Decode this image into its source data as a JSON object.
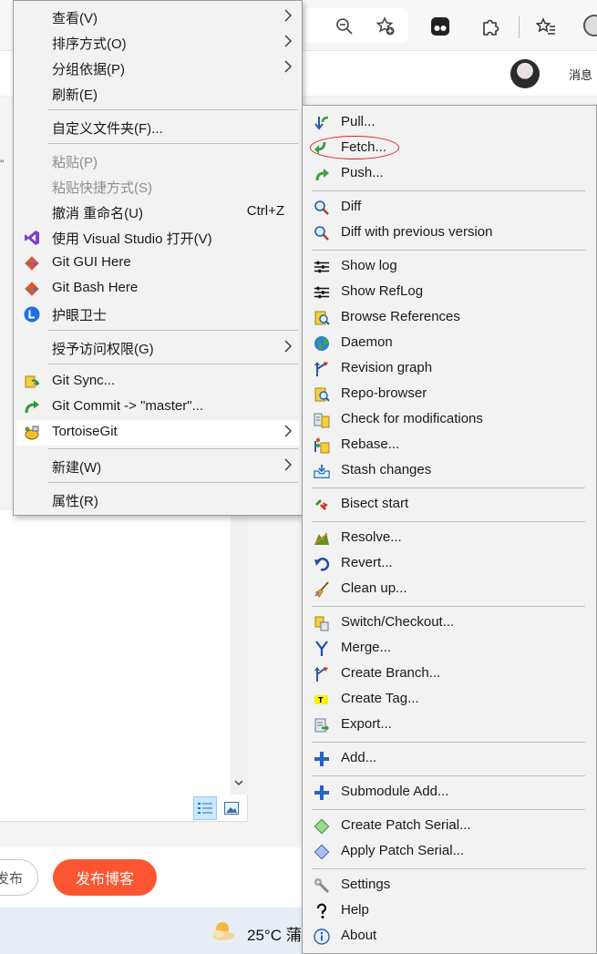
{
  "browser": {
    "message_label": "消息"
  },
  "editor": {
    "quote_char": "\"",
    "btn_secondary": "发布",
    "btn_publish": "发布博客"
  },
  "taskbar": {
    "temperature": "25°C",
    "weather_trailing": "蒲"
  },
  "main_menu": {
    "view": "查看(V)",
    "sort": "排序方式(O)",
    "group": "分组依据(P)",
    "refresh": "刷新(E)",
    "customize": "自定义文件夹(F)...",
    "paste": "粘贴(P)",
    "paste_shortcut": "粘贴快捷方式(S)",
    "undo_rename": "撤消 重命名(U)",
    "undo_shortcut": "Ctrl+Z",
    "open_vs": "使用 Visual Studio 打开(V)",
    "git_gui": "Git GUI Here",
    "git_bash": "Git Bash Here",
    "eye_guard": "护眼卫士",
    "grant_access": "授予访问权限(G)",
    "git_sync": "Git Sync...",
    "git_commit": "Git Commit -> \"master\"...",
    "tortoisegit": "TortoiseGit",
    "new": "新建(W)",
    "properties": "属性(R)"
  },
  "sub_menu": {
    "pull": "Pull...",
    "fetch": "Fetch...",
    "push": "Push...",
    "diff": "Diff",
    "diff_prev": "Diff with previous version",
    "show_log": "Show log",
    "show_reflog": "Show RefLog",
    "browse_refs": "Browse References",
    "daemon": "Daemon",
    "revision_graph": "Revision graph",
    "repo_browser": "Repo-browser",
    "check_mods": "Check for modifications",
    "rebase": "Rebase...",
    "stash": "Stash changes",
    "bisect": "Bisect start",
    "resolve": "Resolve...",
    "revert": "Revert...",
    "cleanup": "Clean up...",
    "switch": "Switch/Checkout...",
    "merge": "Merge...",
    "create_branch": "Create Branch...",
    "create_tag": "Create Tag...",
    "export": "Export...",
    "add": "Add...",
    "submodule_add": "Submodule Add...",
    "create_patch": "Create Patch Serial...",
    "apply_patch": "Apply Patch Serial...",
    "settings": "Settings",
    "help": "Help",
    "about": "About"
  }
}
